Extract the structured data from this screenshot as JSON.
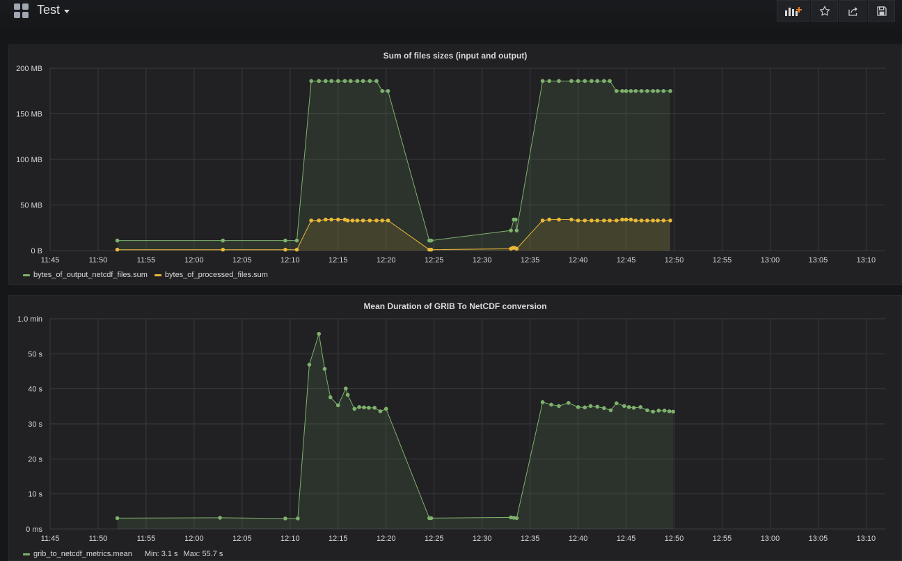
{
  "dashboard": {
    "title": "Test"
  },
  "toolbar": {
    "buttons": [
      {
        "name": "add-panel-button",
        "icon": "add-panel-icon"
      },
      {
        "name": "star-button",
        "icon": "star-icon"
      },
      {
        "name": "share-button",
        "icon": "share-icon"
      },
      {
        "name": "save-button",
        "icon": "save-icon"
      }
    ]
  },
  "colors": {
    "green": "#7eb26d",
    "yellow": "#eab839",
    "bg": "#161719",
    "panel": "#212124"
  },
  "panels": [
    {
      "title": "Sum of files sizes (input and output)",
      "legend": [
        {
          "label": "bytes_of_output_netcdf_files.sum",
          "color": "#7eb26d"
        },
        {
          "label": "bytes_of_processed_files.sum",
          "color": "#eab839"
        }
      ]
    },
    {
      "title": "Mean Duration of GRIB To NetCDF conversion",
      "legend": [
        {
          "label": "grib_to_netcdf_metrics.mean",
          "color": "#7eb26d",
          "min": "Min: 3.1 s",
          "max": "Max: 55.7 s"
        }
      ]
    }
  ],
  "chart_data": [
    {
      "type": "line",
      "title": "Sum of files sizes (input and output)",
      "x_unit": "minutes (clock time)",
      "y_unit": "MB",
      "xlim": [
        "11:45",
        "13:12"
      ],
      "ylim": [
        0,
        200
      ],
      "x_ticks": [
        "11:45",
        "11:50",
        "11:55",
        "12:00",
        "12:05",
        "12:10",
        "12:15",
        "12:20",
        "12:25",
        "12:30",
        "12:35",
        "12:40",
        "12:45",
        "12:50",
        "12:55",
        "13:00",
        "13:05",
        "13:10"
      ],
      "y_ticks": [
        "0 B",
        "50 MB",
        "100 MB",
        "150 MB",
        "200 MB"
      ],
      "grid": true,
      "legend_position": "bottom-left",
      "series": [
        {
          "name": "bytes_of_output_netcdf_files.sum",
          "color": "#7eb26d",
          "fill": true,
          "points": [
            [
              "11:52",
              11
            ],
            [
              "12:03",
              11
            ],
            [
              "12:09.5",
              11
            ],
            [
              "12:10.7",
              11
            ],
            [
              "12:12.2",
              186
            ],
            [
              "12:13",
              186
            ],
            [
              "12:13.7",
              186
            ],
            [
              "12:14.3",
              186
            ],
            [
              "12:15",
              186
            ],
            [
              "12:15.7",
              186
            ],
            [
              "12:16.3",
              186
            ],
            [
              "12:17",
              186
            ],
            [
              "12:17.6",
              186
            ],
            [
              "12:18.3",
              186
            ],
            [
              "12:19",
              186
            ],
            [
              "12:19.6",
              175
            ],
            [
              "12:20.2",
              175
            ],
            [
              "12:24.5",
              11
            ],
            [
              "12:24.7",
              11
            ],
            [
              "12:33",
              22
            ],
            [
              "12:33.3",
              34
            ],
            [
              "12:33.5",
              34
            ],
            [
              "12:33.6",
              22
            ],
            [
              "12:36.3",
              186
            ],
            [
              "12:37",
              186
            ],
            [
              "12:38",
              186
            ],
            [
              "12:39.3",
              186
            ],
            [
              "12:40",
              186
            ],
            [
              "12:40.7",
              186
            ],
            [
              "12:41.4",
              186
            ],
            [
              "12:42",
              186
            ],
            [
              "12:42.7",
              186
            ],
            [
              "12:43.3",
              186
            ],
            [
              "12:44",
              175
            ],
            [
              "12:44.6",
              175
            ],
            [
              "12:45",
              175
            ],
            [
              "12:45.5",
              175
            ],
            [
              "12:46",
              175
            ],
            [
              "12:46.6",
              175
            ],
            [
              "12:47.2",
              175
            ],
            [
              "12:47.8",
              175
            ],
            [
              "12:48.3",
              175
            ],
            [
              "12:48.9",
              175
            ],
            [
              "12:49.6",
              175
            ]
          ]
        },
        {
          "name": "bytes_of_processed_files.sum",
          "color": "#eab839",
          "fill": true,
          "points": [
            [
              "11:52",
              1
            ],
            [
              "12:03",
              1
            ],
            [
              "12:09.5",
              1
            ],
            [
              "12:10.7",
              1
            ],
            [
              "12:12.2",
              33
            ],
            [
              "12:13",
              33
            ],
            [
              "12:13.7",
              34
            ],
            [
              "12:14.3",
              34
            ],
            [
              "12:15",
              34
            ],
            [
              "12:15.7",
              34
            ],
            [
              "12:16",
              33
            ],
            [
              "12:16.5",
              33
            ],
            [
              "12:17",
              33
            ],
            [
              "12:17.6",
              33
            ],
            [
              "12:18.3",
              33
            ],
            [
              "12:19",
              33
            ],
            [
              "12:19.6",
              33
            ],
            [
              "12:20.2",
              33
            ],
            [
              "12:24.5",
              1
            ],
            [
              "12:24.7",
              1
            ],
            [
              "12:33",
              2
            ],
            [
              "12:33.2",
              3
            ],
            [
              "12:33.4",
              3
            ],
            [
              "12:33.6",
              2
            ],
            [
              "12:36.3",
              33
            ],
            [
              "12:37",
              34
            ],
            [
              "12:38",
              34
            ],
            [
              "12:39.3",
              34
            ],
            [
              "12:40",
              33
            ],
            [
              "12:40.7",
              33
            ],
            [
              "12:41.4",
              33
            ],
            [
              "12:42",
              33
            ],
            [
              "12:42.7",
              33
            ],
            [
              "12:43.3",
              33
            ],
            [
              "12:44",
              33
            ],
            [
              "12:44.6",
              34
            ],
            [
              "12:45",
              34
            ],
            [
              "12:45.5",
              34
            ],
            [
              "12:46",
              33
            ],
            [
              "12:46.6",
              33
            ],
            [
              "12:47.2",
              33
            ],
            [
              "12:47.8",
              33
            ],
            [
              "12:48.3",
              33
            ],
            [
              "12:48.9",
              33
            ],
            [
              "12:49.6",
              33
            ]
          ]
        }
      ]
    },
    {
      "type": "line",
      "title": "Mean Duration of GRIB To NetCDF conversion",
      "x_unit": "minutes (clock time)",
      "y_unit": "seconds",
      "xlim": [
        "11:45",
        "13:12"
      ],
      "ylim": [
        0,
        60
      ],
      "x_ticks": [
        "11:45",
        "11:50",
        "11:55",
        "12:00",
        "12:05",
        "12:10",
        "12:15",
        "12:20",
        "12:25",
        "12:30",
        "12:35",
        "12:40",
        "12:45",
        "12:50",
        "12:55",
        "13:00",
        "13:05",
        "13:10"
      ],
      "y_ticks": [
        "0 ms",
        "10 s",
        "20 s",
        "30 s",
        "40 s",
        "50 s",
        "1.0 min"
      ],
      "grid": true,
      "legend_position": "bottom-left",
      "series": [
        {
          "name": "grib_to_netcdf_metrics.mean",
          "color": "#7eb26d",
          "fill": true,
          "points": [
            [
              "11:52",
              3.1
            ],
            [
              "12:02.7",
              3.2
            ],
            [
              "12:09.5",
              3.0
            ],
            [
              "12:10.8",
              3.0
            ],
            [
              "12:12",
              46.9
            ],
            [
              "12:13",
              55.7
            ],
            [
              "12:13.6",
              45.7
            ],
            [
              "12:14.2",
              37.6
            ],
            [
              "12:15",
              35.3
            ],
            [
              "12:15.8",
              40.1
            ],
            [
              "12:16",
              38.3
            ],
            [
              "12:16.7",
              34.3
            ],
            [
              "12:17.2",
              34.8
            ],
            [
              "12:17.7",
              34.7
            ],
            [
              "12:18.2",
              34.6
            ],
            [
              "12:18.8",
              34.6
            ],
            [
              "12:19.4",
              33.6
            ],
            [
              "12:20",
              34.3
            ],
            [
              "12:24.5",
              3.1
            ],
            [
              "12:24.7",
              3.1
            ],
            [
              "12:33",
              3.3
            ],
            [
              "12:33.3",
              3.2
            ],
            [
              "12:33.6",
              3.1
            ],
            [
              "12:36.3",
              36.2
            ],
            [
              "12:37.2",
              35.5
            ],
            [
              "12:38",
              35.1
            ],
            [
              "12:39",
              36.0
            ],
            [
              "12:40",
              34.8
            ],
            [
              "12:40.7",
              34.7
            ],
            [
              "12:41.3",
              35.1
            ],
            [
              "12:42",
              34.9
            ],
            [
              "12:42.7",
              34.5
            ],
            [
              "12:43.4",
              33.9
            ],
            [
              "12:44",
              35.9
            ],
            [
              "12:44.8",
              35.1
            ],
            [
              "12:45.3",
              34.8
            ],
            [
              "12:45.8",
              34.6
            ],
            [
              "12:46.5",
              34.8
            ],
            [
              "12:47.2",
              33.9
            ],
            [
              "12:47.8",
              33.5
            ],
            [
              "12:48.4",
              33.8
            ],
            [
              "12:49",
              33.8
            ],
            [
              "12:49.5",
              33.6
            ],
            [
              "12:49.9",
              33.5
            ]
          ]
        }
      ]
    }
  ]
}
